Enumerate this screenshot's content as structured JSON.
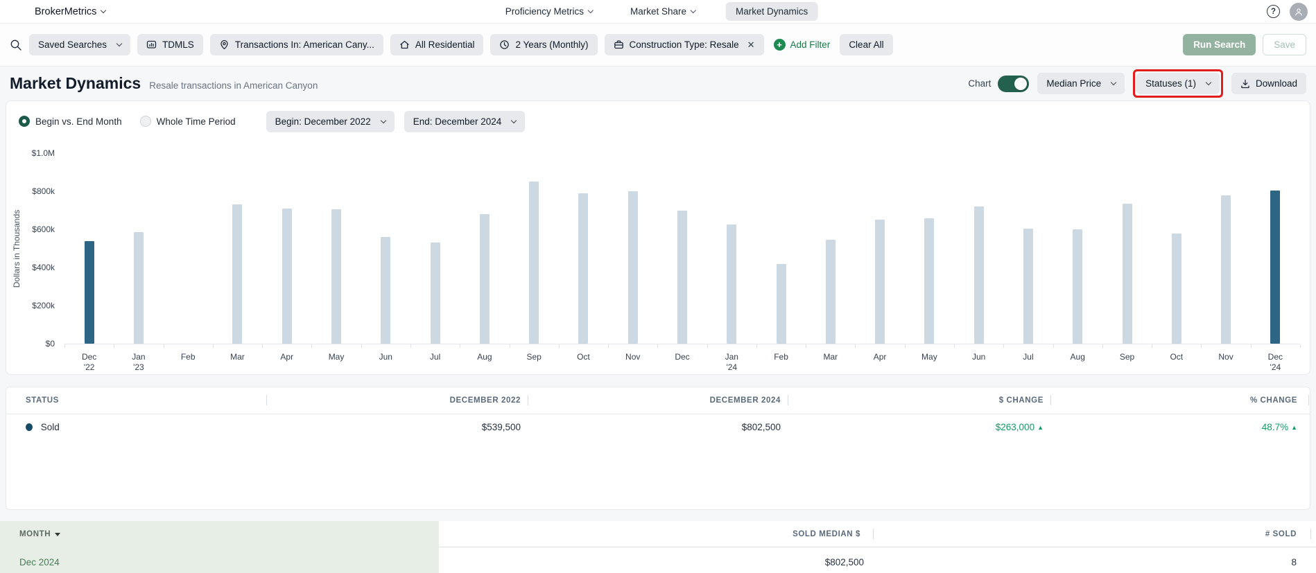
{
  "nav": {
    "brand": "BrokerMetrics",
    "tabs": [
      {
        "label": "Proficiency Metrics"
      },
      {
        "label": "Market Share"
      },
      {
        "label": "Market Dynamics"
      }
    ]
  },
  "icons": {
    "help": "?",
    "close": "✕",
    "plus": "+",
    "up_arrow": "▲"
  },
  "filter_bar": {
    "saved_searches": "Saved Searches",
    "filters": [
      {
        "icon": "mls-source-icon",
        "label": "TDMLS"
      },
      {
        "icon": "location-pin-icon",
        "label": "Transactions In: American Cany..."
      },
      {
        "icon": "house-icon",
        "label": "All Residential"
      },
      {
        "icon": "clock-icon",
        "label": "2 Years (Monthly)"
      },
      {
        "icon": "briefcase-icon",
        "label": "Construction Type: Resale",
        "removable": true
      }
    ],
    "add_filter": "Add Filter",
    "clear_all": "Clear All",
    "run_search": "Run Search",
    "save": "Save"
  },
  "header": {
    "title": "Market Dynamics",
    "subtitle": "Resale transactions in American Canyon",
    "chart_toggle_label": "Chart",
    "chart_toggle_on": true,
    "metric_dropdown": "Median Price",
    "statuses_dropdown": "Statuses (1)",
    "download": "Download",
    "statuses_highlight_color": "#e31c1c"
  },
  "controls": {
    "radio_begin_end": "Begin vs. End Month",
    "radio_whole_period": "Whole Time Period",
    "selected_radio": "Begin vs. End Month",
    "begin_dropdown": "Begin: December 2022",
    "end_dropdown": "End: December 2024"
  },
  "chart_data": {
    "type": "bar",
    "ylabel": "Dollars in Thousands",
    "ylim": [
      0,
      1000000
    ],
    "grid": false,
    "bar_color_default": "#cdd9e2",
    "bar_color_highlight": "#2f6584",
    "yticks": [
      {
        "label": "$1.0M",
        "value": 1000000
      },
      {
        "label": "$800k",
        "value": 800000
      },
      {
        "label": "$600k",
        "value": 600000
      },
      {
        "label": "$400k",
        "value": 400000
      },
      {
        "label": "$200k",
        "value": 200000
      },
      {
        "label": "$0",
        "value": 0
      }
    ],
    "months": [
      {
        "label": "Dec",
        "year": "'22",
        "value": 539500,
        "highlight": true
      },
      {
        "label": "Jan",
        "year": "'23",
        "value": 585000
      },
      {
        "label": "Feb",
        "value": null
      },
      {
        "label": "Mar",
        "value": 730000
      },
      {
        "label": "Apr",
        "value": 710000
      },
      {
        "label": "May",
        "value": 705000
      },
      {
        "label": "Jun",
        "value": 560000
      },
      {
        "label": "Jul",
        "value": 530000
      },
      {
        "label": "Aug",
        "value": 680000
      },
      {
        "label": "Sep",
        "value": 850000
      },
      {
        "label": "Oct",
        "value": 790000
      },
      {
        "label": "Nov",
        "value": 800000
      },
      {
        "label": "Dec",
        "value": 700000
      },
      {
        "label": "Jan",
        "year": "'24",
        "value": 625000
      },
      {
        "label": "Feb",
        "value": 420000
      },
      {
        "label": "Mar",
        "value": 545000
      },
      {
        "label": "Apr",
        "value": 650000
      },
      {
        "label": "May",
        "value": 660000
      },
      {
        "label": "Jun",
        "value": 720000
      },
      {
        "label": "Jul",
        "value": 605000
      },
      {
        "label": "Aug",
        "value": 600000
      },
      {
        "label": "Sep",
        "value": 735000
      },
      {
        "label": "Oct",
        "value": 580000
      },
      {
        "label": "Nov",
        "value": 780000
      },
      {
        "label": "Dec",
        "year": "'24",
        "value": 802500,
        "highlight": true
      }
    ]
  },
  "status_table": {
    "headers": [
      "STATUS",
      "DECEMBER 2022",
      "DECEMBER 2024",
      "$ CHANGE",
      "% CHANGE"
    ],
    "rows": [
      {
        "status": "Sold",
        "dot_color": "#174a66",
        "dec2022": "$539,500",
        "dec2024": "$802,500",
        "dollar_change": "$263,000",
        "dollar_change_dir": "up",
        "pct_change": "48.7%",
        "pct_change_dir": "up"
      }
    ]
  },
  "month_table": {
    "headers": [
      "MONTH",
      "SOLD MEDIAN $",
      "# SOLD"
    ],
    "sort_column": "MONTH",
    "sort_direction": "desc",
    "rows": [
      {
        "month": "Dec 2024",
        "sold_median": "$802,500",
        "num_sold": "8"
      }
    ]
  }
}
